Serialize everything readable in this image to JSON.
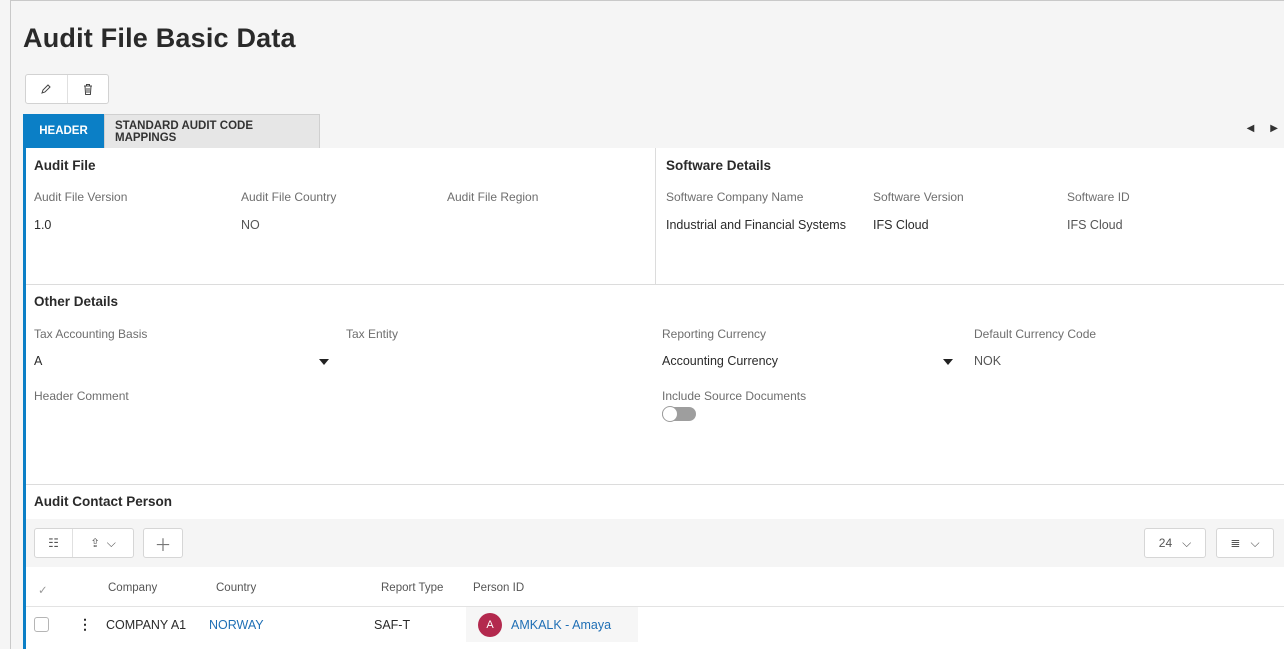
{
  "page": {
    "title": "Audit File Basic Data"
  },
  "toolbar": {
    "edit_icon": "pencil-icon",
    "delete_icon": "trash-icon"
  },
  "tabs": [
    {
      "label": "HEADER",
      "active": true
    },
    {
      "label": "STANDARD AUDIT CODE MAPPINGS",
      "active": false
    }
  ],
  "colors": {
    "accent": "#0b7fc6",
    "link": "#1f6fb5",
    "avatar": "#b3294e"
  },
  "audit_file": {
    "title": "Audit File",
    "version_label": "Audit File Version",
    "version_value": "1.0",
    "country_label": "Audit File Country",
    "country_value": "NO",
    "region_label": "Audit File Region",
    "region_value": ""
  },
  "software": {
    "title": "Software Details",
    "company_label": "Software Company Name",
    "company_value": "Industrial and Financial Systems",
    "version_label": "Software Version",
    "version_value": "IFS Cloud",
    "id_label": "Software ID",
    "id_value": "IFS Cloud"
  },
  "other": {
    "title": "Other Details",
    "tax_basis_label": "Tax Accounting Basis",
    "tax_basis_value": "A",
    "tax_entity_label": "Tax Entity",
    "tax_entity_value": "",
    "reporting_currency_label": "Reporting Currency",
    "reporting_currency_value": "Accounting Currency",
    "default_currency_label": "Default Currency Code",
    "default_currency_value": "NOK",
    "header_comment_label": "Header Comment",
    "include_source_label": "Include Source Documents",
    "include_source_on": false
  },
  "contacts": {
    "title": "Audit Contact Person",
    "page_size": "24",
    "columns": [
      "Company",
      "Country",
      "Report Type",
      "Person ID"
    ],
    "rows": [
      {
        "company": "COMPANY A1",
        "country": "NORWAY",
        "report_type": "SAF-T",
        "avatar_letter": "A",
        "person": "AMKALK - Amaya"
      }
    ]
  }
}
